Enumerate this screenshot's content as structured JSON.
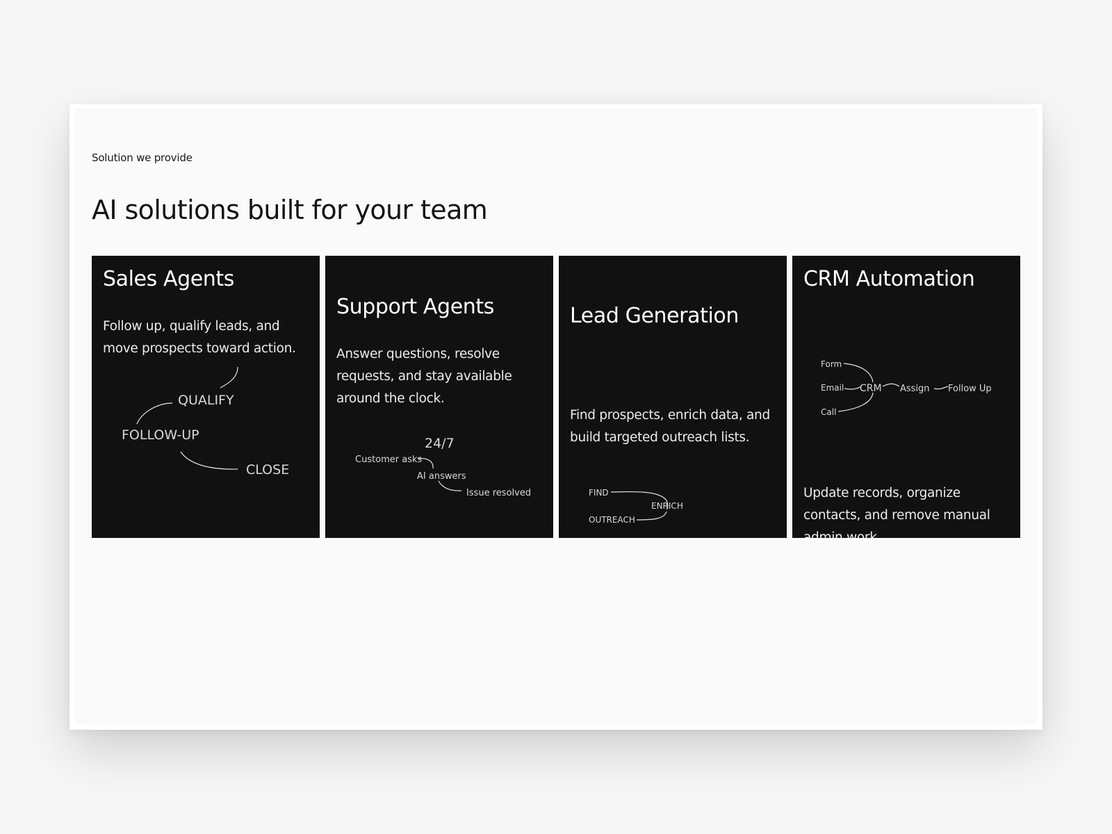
{
  "section": {
    "eyebrow": "Solution we provide",
    "headline": "AI solutions built for your team"
  },
  "cards": [
    {
      "title": "Sales Agents",
      "description": "Follow up, qualify leads, and move prospects toward action.",
      "diagram": {
        "nodes": [
          "QUALIFY",
          "FOLLOW-UP",
          "CLOSE"
        ]
      }
    },
    {
      "title": "Support Agents",
      "description": "Answer questions, resolve requests, and stay available around the clock.",
      "diagram": {
        "badge": "24/7",
        "steps": [
          "Customer asks",
          "AI answers",
          "Issue resolved"
        ]
      }
    },
    {
      "title": "Lead Generation",
      "description": "Find prospects, enrich data, and build targeted outreach lists.",
      "diagram": {
        "steps": [
          "FIND",
          "ENRICH",
          "OUTREACH"
        ]
      }
    },
    {
      "title": "CRM Automation",
      "description": "Update records, organize contacts, and remove manual admin work.",
      "diagram": {
        "inputs": [
          "Form",
          "Email",
          "Call"
        ],
        "hub": "CRM",
        "flow": [
          "Assign",
          "Follow Up"
        ]
      }
    }
  ]
}
